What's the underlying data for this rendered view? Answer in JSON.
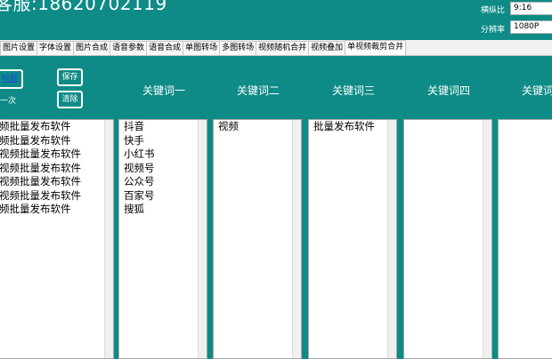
{
  "header": {
    "title": "客服:18620702119",
    "ratio_label": "横纵比",
    "ratio_value": "9:16",
    "resolution_label": "分辨率",
    "resolution_value": "1080P"
  },
  "tabs": [
    "图片设置",
    "字体设置",
    "图片合成",
    "语音参数",
    "语音合成",
    "单图转场",
    "多图转场",
    "视频随机合并",
    "视频叠加",
    "单视频裁剪合并"
  ],
  "controls": {
    "select_title_label": "标题",
    "once_label": "一次",
    "save_label": "保存",
    "clear_label": "清除"
  },
  "columns": [
    {
      "header": "",
      "items": [
        "频批量发布软件",
        "频批量发布软件",
        "视频批量发布软件",
        "视频批量发布软件",
        "视频批量发布软件",
        "视频批量发布软件",
        "频批量发布软件"
      ]
    },
    {
      "header": "关键词一",
      "items": [
        "抖音",
        "快手",
        "小红书",
        "视频号",
        "公众号",
        "百家号",
        "搜狐"
      ]
    },
    {
      "header": "关键词二",
      "items": [
        "视频"
      ]
    },
    {
      "header": "关键词三",
      "items": [
        "批量发布软件"
      ]
    },
    {
      "header": "关键词四",
      "items": []
    },
    {
      "header": "关键词",
      "items": []
    }
  ]
}
